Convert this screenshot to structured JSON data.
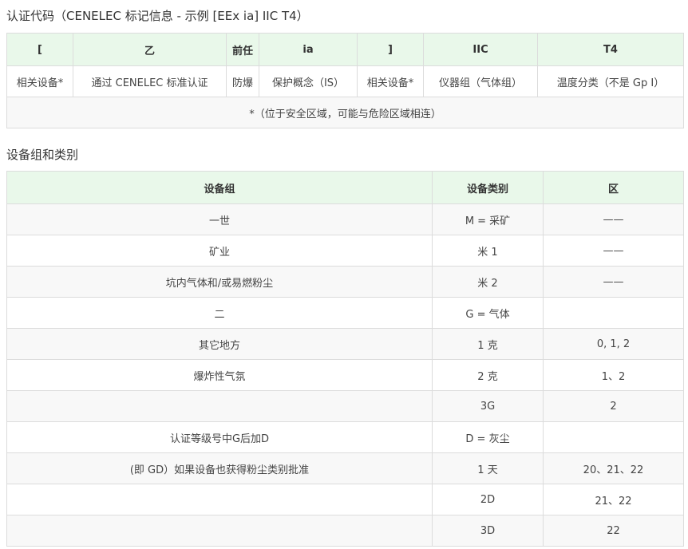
{
  "table1": {
    "title": "认证代码（CENELEC 标记信息 - 示例 [EEx ia] IIC T4）",
    "headers": [
      "[",
      "乙",
      "前任",
      "ia",
      "]",
      "IIC",
      "T4"
    ],
    "row": [
      "相关设备*",
      "通过 CENELEC 标准认证",
      "防爆",
      "保护概念（IS）",
      "相关设备*",
      "仪器组（气体组）",
      "温度分类（不是 Gp I）"
    ],
    "note": "*（位于安全区域，可能与危险区域相连）"
  },
  "table2": {
    "title": "设备组和类别",
    "headers": [
      "设备组",
      "设备类别",
      "区"
    ],
    "rows": [
      [
        "一世",
        "M = 采矿",
        "——"
      ],
      [
        "矿业",
        "米 1",
        "——"
      ],
      [
        "坑内气体和/或易燃粉尘",
        "米 2",
        "——"
      ],
      [
        "二",
        "G = 气体",
        ""
      ],
      [
        "其它地方",
        "1 克",
        "0, 1, 2"
      ],
      [
        "爆炸性气氛",
        "2 克",
        "1、2"
      ],
      [
        "",
        "3G",
        "2"
      ],
      [
        "认证等级号中G后加D",
        "D = 灰尘",
        ""
      ],
      [
        "(即 GD）如果设备也获得粉尘类别批准",
        "1 天",
        "20、21、22"
      ],
      [
        "",
        "2D",
        "21、22"
      ],
      [
        "",
        "3D",
        "22"
      ]
    ]
  }
}
